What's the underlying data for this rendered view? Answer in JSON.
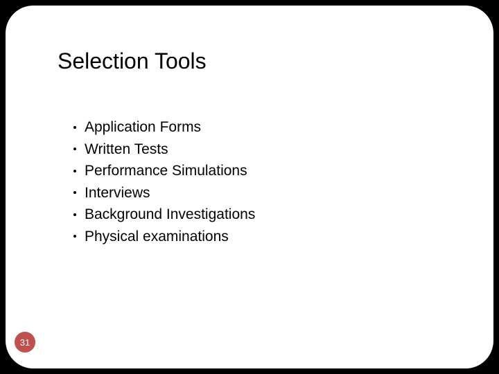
{
  "slide": {
    "title": "Selection Tools",
    "bullets": [
      "Application Forms",
      "Written Tests",
      "Performance Simulations",
      "Interviews",
      "Background Investigations",
      "Physical examinations"
    ],
    "page_number": "31"
  }
}
